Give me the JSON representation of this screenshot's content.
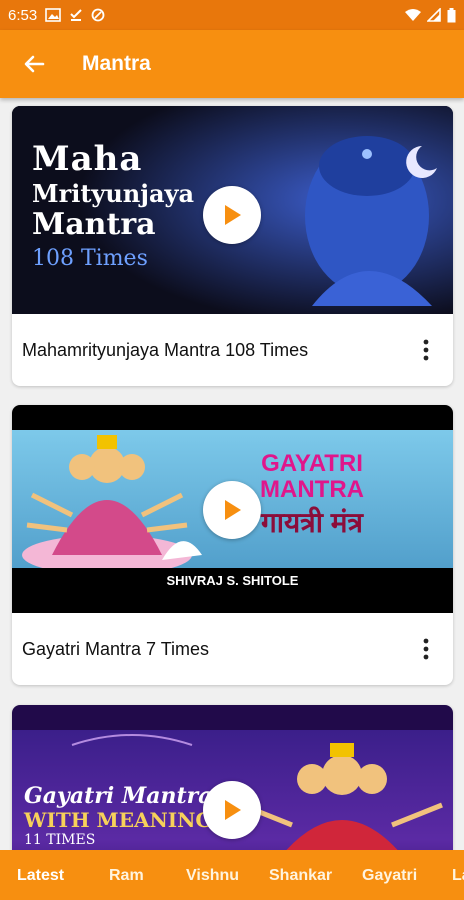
{
  "status_bar": {
    "time": "6:53"
  },
  "app_bar": {
    "title": "Mantra"
  },
  "videos": [
    {
      "title": "Mahamrityunjaya Mantra 108 Times",
      "thumb_lines": [
        "Maha",
        "Mrityunjaya",
        "Mantra",
        "108 Times"
      ]
    },
    {
      "title": "Gayatri Mantra 7 Times",
      "thumb_lines": [
        "GAYATRI",
        "MANTRA",
        "गायत्री मंत्र",
        "SHIVRAJ S. SHITOLE"
      ]
    },
    {
      "thumb_lines": [
        "Gayatri Mantra",
        "WITH MEANING",
        "11 TIMES"
      ]
    }
  ],
  "bottom_nav": {
    "items": [
      "Latest",
      "Ram",
      "Vishnu",
      "Shankar",
      "Gayatri",
      "La"
    ],
    "active": "Latest"
  },
  "colors": {
    "primary": "#f78f10",
    "status": "#e8770c",
    "play_triangle": "#f78f10"
  }
}
